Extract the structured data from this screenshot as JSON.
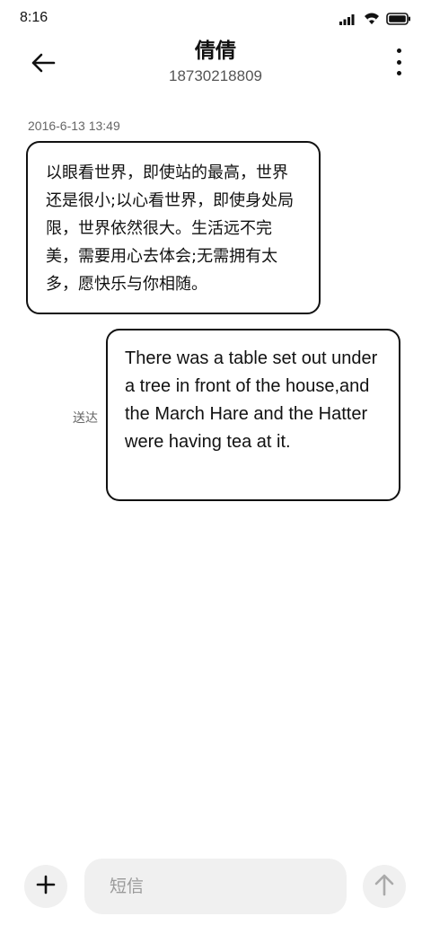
{
  "status_bar": {
    "time": "8:16",
    "icons": [
      "signal-icon",
      "wifi-icon",
      "battery-icon"
    ]
  },
  "header": {
    "back_icon": "arrow-left-icon",
    "contact_name": "倩倩",
    "contact_number": "18730218809",
    "more_icon": "more-vertical-icon"
  },
  "conversation": {
    "timestamp": "2016-6-13 13:49",
    "messages": [
      {
        "direction": "incoming",
        "text": "以眼看世界，即使站的最高，世界还是很小;以心看世界，即使身处局限，世界依然很大。生活远不完美，需要用心去体会;无需拥有太多，愿快乐与你相随。"
      },
      {
        "direction": "outgoing",
        "text": "There was a table set out under a tree in front of the house,and the March Hare and the Hatter were having tea at it.",
        "status": "送达"
      }
    ]
  },
  "composer": {
    "add_icon": "plus-icon",
    "placeholder": "短信",
    "value": "",
    "send_icon": "arrow-up-icon"
  },
  "colors": {
    "background": "#ffffff",
    "bubble_border": "#111111",
    "input_bg": "#f0f0f0",
    "muted_text": "#666666"
  }
}
